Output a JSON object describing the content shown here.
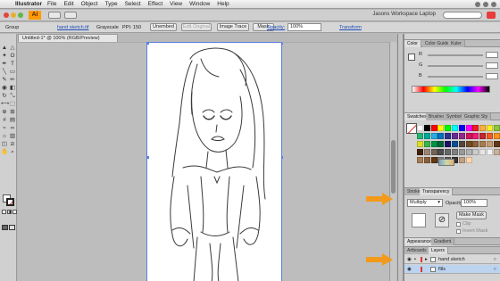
{
  "menubar": {
    "app_name": "Illustrator",
    "items": [
      "File",
      "Edit",
      "Object",
      "Type",
      "Select",
      "Effect",
      "View",
      "Window",
      "Help"
    ]
  },
  "appbar": {
    "logo": "Ai",
    "workspace": "Jasons Workspace Laptop"
  },
  "controlbar": {
    "group_label": "Group",
    "link_label": "hand sketch.tif",
    "mode": "Grayscale",
    "ppi": "PPI: 150",
    "unembed_label": "Unembed",
    "edit_original_label": "Edit Original",
    "image_trace_label": "Image Trace",
    "mask_label": "Mask",
    "opacity_label": "Opacity:",
    "opacity_value": "100%",
    "transform_label": "Transform"
  },
  "document": {
    "tab_title": "Untitled-1* @ 100% (RGB/Preview)"
  },
  "color_panel": {
    "tabs": [
      "Color",
      "Color Guide",
      "Kuler"
    ],
    "channels": [
      "R",
      "G",
      "B"
    ]
  },
  "swatches_panel": {
    "tabs": [
      "Swatches",
      "Brushes",
      "Symbols",
      "Graphic Sty"
    ]
  },
  "transparency_panel": {
    "tabs": [
      "Stroke",
      "Transparency"
    ],
    "blend_mode": "Multiply",
    "opacity_label": "Opacity:",
    "opacity_value": "100%",
    "make_mask_label": "Make Mask",
    "clip_label": "Clip",
    "invert_mask_label": "Invert Mask"
  },
  "appearance_panel": {
    "tabs": [
      "Appearance",
      "Gradient"
    ]
  },
  "layers_panel": {
    "tabs": [
      "Artboards",
      "Layers"
    ],
    "rows": [
      {
        "name": "hand sketch",
        "selected": false
      },
      {
        "name": "fills",
        "selected": true
      }
    ]
  },
  "colors": {
    "accent_arrow": "#f39a1a",
    "selection_blue": "#5d7ee0",
    "logo_orange": "#ff9a00"
  },
  "swatch_colors": [
    "#ffffff",
    "#000000",
    "#ff0000",
    "#ffff00",
    "#00ff00",
    "#00ffff",
    "#0000ff",
    "#ff00ff",
    "#ed1c24",
    "#fbb03b",
    "#fcee21",
    "#8cc63f",
    "#22b573",
    "#00a99d",
    "#29abe2",
    "#0071bc",
    "#2e3192",
    "#662d91",
    "#93278f",
    "#d4145a",
    "#ed1e79",
    "#c1272d",
    "#f15a24",
    "#f7931e",
    "#d9e021",
    "#39b54a",
    "#009245",
    "#006837",
    "#1b1464",
    "#0b4f8f",
    "#534741",
    "#754c24",
    "#8c6239",
    "#a67c52",
    "#c69c6d",
    "#603813",
    "#42210b",
    "#998675",
    "#736357",
    "#4d4d4d",
    "#666666",
    "#808080",
    "#999999",
    "#b3b3b3",
    "#cccccc",
    "#e6e6e6",
    "#f2f2f2",
    "#c7b299",
    "#a67c52",
    "#8b5e3c",
    "#603813",
    "#7f7f7f",
    "#5a5a5a",
    "#333333",
    "#bfa080",
    "#ffd8b0"
  ]
}
